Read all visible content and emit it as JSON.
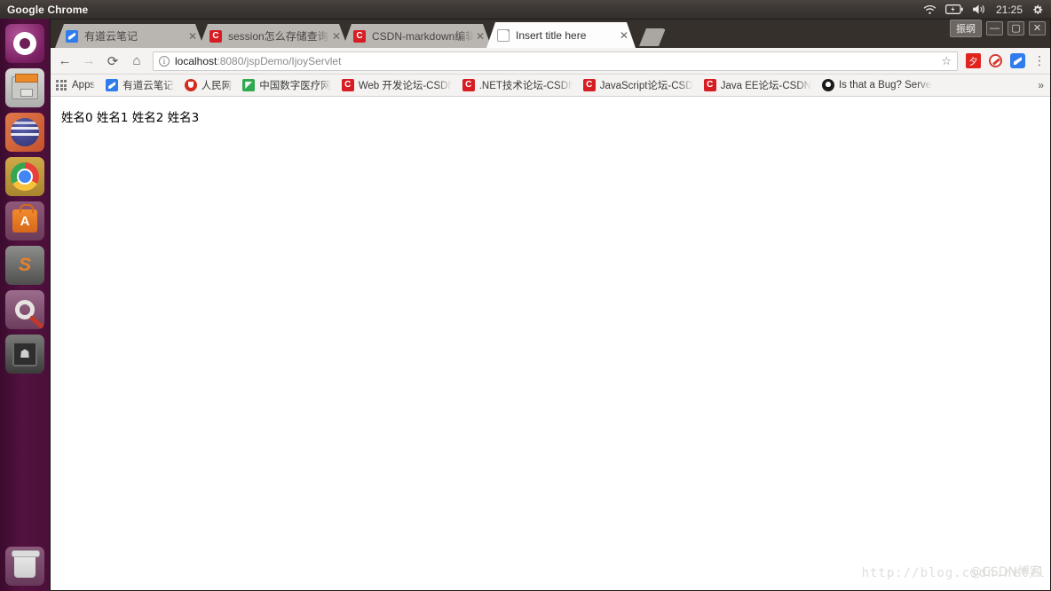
{
  "desktop": {
    "panel": {
      "app_name": "Google Chrome",
      "clock": "21:25",
      "icons": [
        "wifi-icon",
        "battery-icon",
        "volume-icon",
        "gear-icon"
      ]
    },
    "launcher": {
      "items": [
        {
          "name": "ubuntu-dash",
          "label": "Ubuntu"
        },
        {
          "name": "files",
          "label": "Files"
        },
        {
          "name": "eclipse",
          "label": "Eclipse"
        },
        {
          "name": "chrome",
          "label": "Google Chrome"
        },
        {
          "name": "ubuntu-software",
          "label": "A"
        },
        {
          "name": "sublime-text",
          "label": "S"
        },
        {
          "name": "system-settings",
          "label": "Settings"
        },
        {
          "name": "terminal",
          "label": "Terminal"
        },
        {
          "name": "trash",
          "label": "Trash"
        }
      ]
    }
  },
  "window": {
    "user_badge": "振纲",
    "controls": {
      "minimize": "—",
      "maximize": "▢",
      "close": "✕"
    }
  },
  "tabs": [
    {
      "title": "有道云笔记",
      "favicon": "youdao-icon",
      "active": false,
      "close": "✕"
    },
    {
      "title": "session怎么存储查询",
      "favicon": "csdn-icon",
      "active": false,
      "close": "✕"
    },
    {
      "title": "CSDN-markdown编辑器",
      "favicon": "csdn-icon",
      "active": false,
      "close": "✕"
    },
    {
      "title": "Insert title here",
      "favicon": "page-icon",
      "active": true,
      "close": "✕"
    }
  ],
  "toolbar": {
    "back": "←",
    "forward": "→",
    "reload": "⟳",
    "home": "⌂",
    "url_host": "localhost",
    "url_rest": ":8080/jspDemo/IjoyServlet",
    "star": "☆",
    "menu": "⋮",
    "extensions": [
      {
        "name": "youdao-clip-extension",
        "label": "夕"
      },
      {
        "name": "adblock-extension",
        "label": ""
      },
      {
        "name": "youdao-note-extension",
        "label": ""
      }
    ]
  },
  "bookmarks": {
    "items": [
      {
        "label": "Apps",
        "icon": "apps-grid-icon"
      },
      {
        "label": "有道云笔记",
        "icon": "youdao-icon"
      },
      {
        "label": "人民网",
        "icon": "renmin-icon"
      },
      {
        "label": "中国数字医疗网",
        "icon": "yiliao-icon"
      },
      {
        "label": "Web 开发论坛-CSDN",
        "icon": "csdn-icon"
      },
      {
        "label": ".NET技术论坛-CSDN",
        "icon": "csdn-icon"
      },
      {
        "label": "JavaScript论坛-CSDN",
        "icon": "csdn-icon"
      },
      {
        "label": "Java EE论坛-CSDN",
        "icon": "csdn-icon"
      },
      {
        "label": "Is that a Bug? Server",
        "icon": "github-icon"
      }
    ],
    "overflow": "»"
  },
  "page": {
    "content": "姓名0 姓名1 姓名2 姓名3",
    "watermark": "http://blog.csdn.net/l",
    "watermark_overlay": "@CSDN博客"
  }
}
